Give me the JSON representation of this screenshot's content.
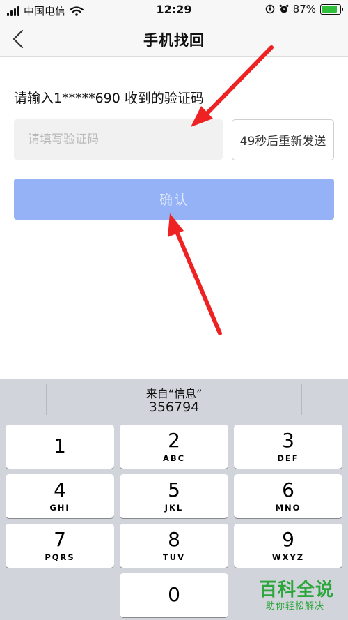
{
  "status_bar": {
    "carrier": "中国电信",
    "time": "12:29",
    "battery_percent": "87%",
    "battery_level": 0.87,
    "icons": [
      "signal-icon",
      "wifi-icon",
      "orientation-lock-icon",
      "alarm-icon",
      "battery-icon"
    ]
  },
  "nav": {
    "back_icon": "chevron-left-icon",
    "title": "手机找回"
  },
  "form": {
    "prompt": "请输入1*****690 收到的验证码",
    "code_input": {
      "value": "",
      "placeholder": "请填写验证码"
    },
    "resend_label": "49秒后重新发送",
    "confirm_label": "确认",
    "confirm_color": "#95b2f6"
  },
  "annotations": {
    "arrow_color": "#ee2222",
    "arrows": [
      "arrow-to-prompt",
      "arrow-to-confirm"
    ]
  },
  "keyboard": {
    "suggestion": {
      "source": "来自“信息”",
      "code": "356794"
    },
    "keys": [
      {
        "num": "1",
        "letters": ""
      },
      {
        "num": "2",
        "letters": "ABC"
      },
      {
        "num": "3",
        "letters": "DEF"
      },
      {
        "num": "4",
        "letters": "GHI"
      },
      {
        "num": "5",
        "letters": "JKL"
      },
      {
        "num": "6",
        "letters": "MNO"
      },
      {
        "num": "7",
        "letters": "PQRS"
      },
      {
        "num": "8",
        "letters": "TUV"
      },
      {
        "num": "9",
        "letters": "WXYZ"
      },
      {
        "num": "0",
        "letters": ""
      }
    ]
  },
  "watermark": {
    "title": "百科全说",
    "subtitle": "助你轻松解决"
  }
}
